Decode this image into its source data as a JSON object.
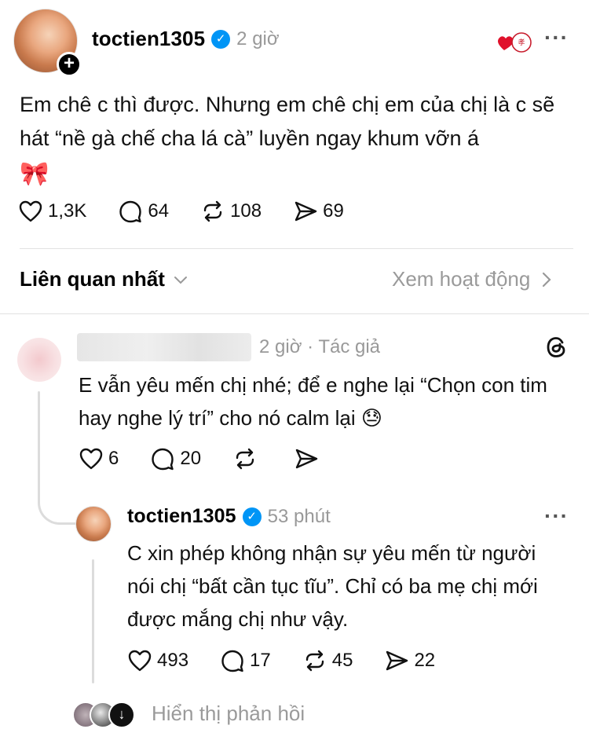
{
  "post": {
    "username": "toctien1305",
    "time": "2 giờ",
    "text": "Em chê c thì được. Nhưng em chê chị em của chị là c sẽ hát “nề gà chế cha lá cà” luyền ngay khum vỡn á",
    "emoji": "🎀",
    "likes": "1,3K",
    "comments": "64",
    "reposts": "108",
    "shares": "69"
  },
  "sort": {
    "label": "Liên quan nhất",
    "activity_link": "Xem hoạt động"
  },
  "reply1": {
    "time": "2 giờ · Tác giả",
    "text": "E vẫn yêu mến chị nhé; để e nghe lại “Chọn con tim hay nghe lý trí” cho nó calm lại",
    "emoji": "😓",
    "likes": "6",
    "comments": "20"
  },
  "reply2": {
    "username": "toctien1305",
    "time": "53 phút",
    "text": "C xin phép không nhận sự yêu mến từ người nói chị “bất cần tục tĩu”. Chỉ có ba mẹ chị mới được mắng chị như vậy.",
    "likes": "493",
    "comments": "17",
    "reposts": "45",
    "shares": "22"
  },
  "show_replies": "Hiển thị phản hồi",
  "colors": {
    "verified": "#0095f6",
    "muted": "#9a9a9a",
    "divider": "#e2e2e2"
  }
}
